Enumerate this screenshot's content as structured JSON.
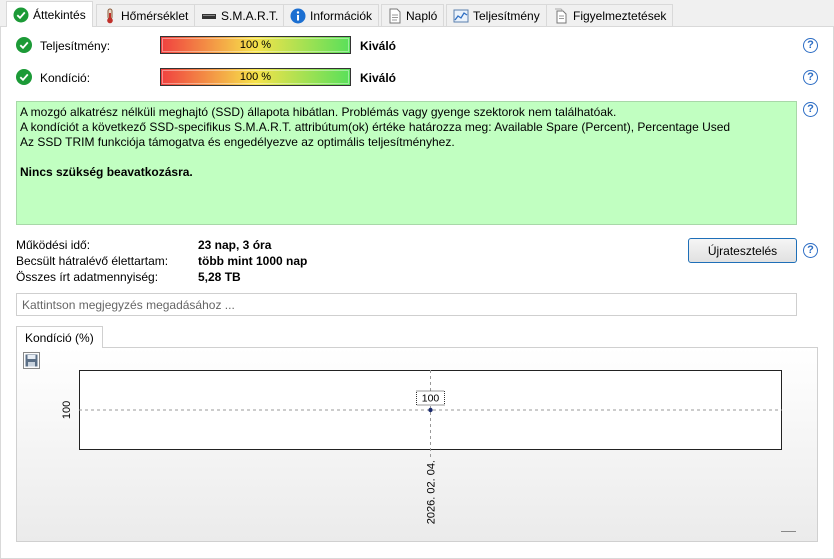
{
  "tabs": [
    {
      "label": "Áttekintés",
      "icon": "check-circle-icon",
      "active": true
    },
    {
      "label": "Hőmérséklet",
      "icon": "thermometer-icon"
    },
    {
      "label": "S.M.A.R.T.",
      "icon": "drive-icon"
    },
    {
      "label": "Információk",
      "icon": "info-icon"
    },
    {
      "label": "Napló",
      "icon": "document-icon"
    },
    {
      "label": "Teljesítmény",
      "icon": "performance-chart-icon"
    },
    {
      "label": "Figyelmeztetések",
      "icon": "alerts-icon"
    }
  ],
  "performance": {
    "label": "Teljesítmény:",
    "value": "100 %",
    "percent": 100,
    "rating": "Kiváló"
  },
  "health": {
    "label": "Kondíció:",
    "value": "100 %",
    "percent": 100,
    "rating": "Kiváló"
  },
  "status": {
    "lines": [
      "A mozgó alkatrész nélküli meghajtó (SSD) állapota hibátlan. Problémás vagy gyenge szektorok nem találhatóak.",
      "A kondíciót a következő SSD-specifikus S.M.A.R.T. attribútum(ok) értéke határozza meg:  Available Spare (Percent), Percentage Used",
      "Az SSD TRIM funkciója támogatva és engedélyezve az optimális teljesítményhez."
    ],
    "verdict": "Nincs szükség beavatkozásra.",
    "color": "#c1ffc1"
  },
  "info": {
    "uptime_label": "Működési idő:",
    "uptime_value": "23 nap, 3 óra",
    "remaining_label": "Becsült hátralévő élettartam:",
    "remaining_value": "több mint 1000 nap",
    "written_label": "Összes írt adatmennyiség:",
    "written_value": "5,28 TB"
  },
  "retest_button": "Újratesztelés",
  "note": {
    "value": "",
    "placeholder": "Kattintson megjegyzés megadásához ..."
  },
  "chart_tab": "Kondíció  (%)",
  "chart_data": {
    "type": "line",
    "x": [
      "2026. 02. 04."
    ],
    "series": [
      {
        "values": [
          100
        ]
      }
    ],
    "point_labels": [
      "100"
    ],
    "y_tick_labels": [
      "100"
    ],
    "x_tick_labels": [
      "2026. 02. 04."
    ],
    "grid": true
  }
}
